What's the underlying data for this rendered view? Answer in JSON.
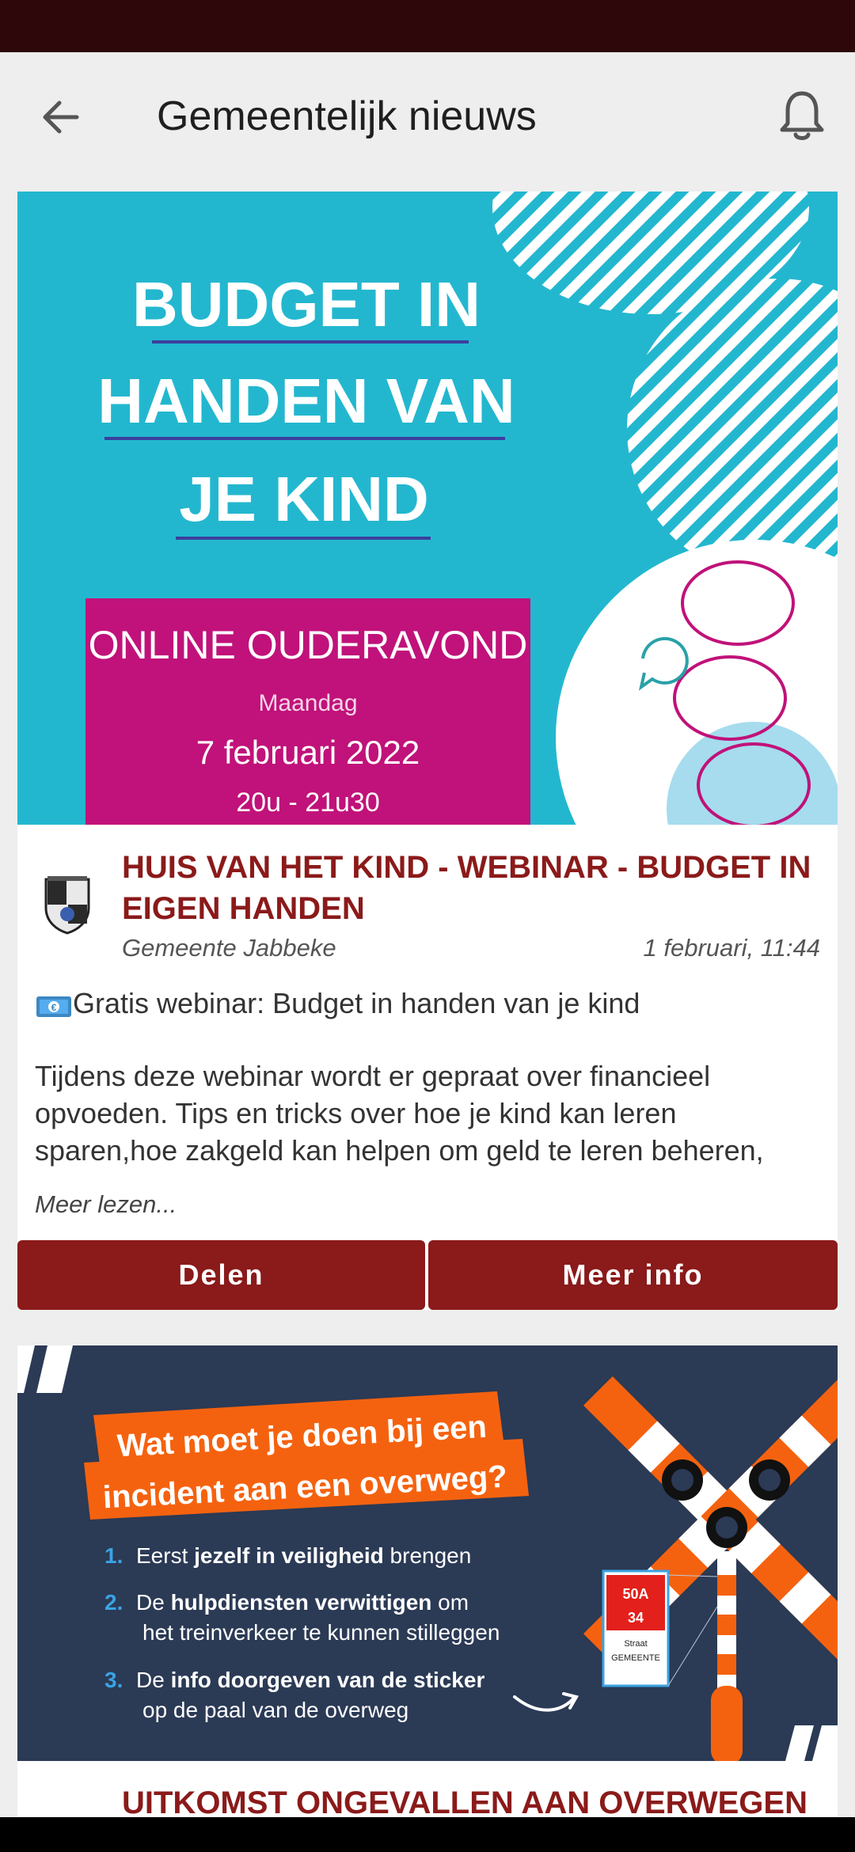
{
  "appbar": {
    "title": "Gemeentelijk nieuws"
  },
  "icons": {
    "back": "arrow-left-icon",
    "bell": "bell-icon",
    "money": "euro-banknote-emoji",
    "crest": "municipal-crest-icon"
  },
  "colors": {
    "statusbar": "#2e070b",
    "accent": "#8b1a1a",
    "background": "#eeeeee",
    "banner1_bg": "#23b7cf",
    "banner1_box": "#c0127a",
    "banner2_bg": "#2b3a55",
    "banner2_orange": "#f5620f"
  },
  "articles": [
    {
      "banner": {
        "line1": "BUDGET IN",
        "line2": "HANDEN VAN",
        "line3": "JE KIND",
        "box_title": "ONLINE OUDERAVOND",
        "box_day": "Maandag",
        "box_date": "7 februari 2022",
        "box_time": "20u - 21u30"
      },
      "headline": "HUIS VAN HET KIND - WEBINAR - BUDGET IN EIGEN HANDEN",
      "author": "Gemeente Jabbeke",
      "date": "1 februari, 11:44",
      "lead": "Gratis webinar: Budget in handen van je kind",
      "body": "Tijdens deze webinar wordt er gepraat over financieel opvoeden. Tips en tricks over hoe je kind kan leren sparen,hoe zakgeld kan helpen om geld te leren beheren,",
      "more": "Meer lezen...",
      "share_label": "Delen",
      "info_label": "Meer info"
    },
    {
      "banner": {
        "title1": "Wat moet je doen bij een",
        "title2": "incident aan een overweg?",
        "n1": "1.",
        "step1a": "Eerst ",
        "step1b": "jezelf in veiligheid",
        "step1c": " brengen",
        "n2": "2.",
        "step2a": "De ",
        "step2b": "hulpdiensten verwittigen",
        "step2c": " om",
        "step2d": "het treinverkeer te kunnen stilleggen",
        "n3": "3.",
        "step3a": "De ",
        "step3b": "info doorgeven van de sticker",
        "step3c": "op de paal van de overweg",
        "sticker_code": "50A",
        "sticker_km": "34",
        "sticker_street": "Straat",
        "sticker_city": "GEMEENTE"
      },
      "headline": "UITKOMST ONGEVALLEN AAN OVERWEGEN"
    }
  ]
}
